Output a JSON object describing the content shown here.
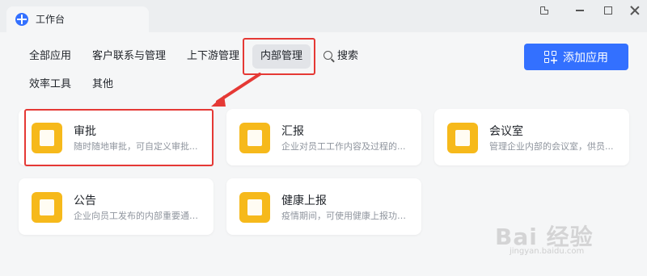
{
  "window": {
    "tab_title": "工作台",
    "icons": [
      "logo-icon",
      "pin-icon",
      "minimize-icon",
      "maximize-icon",
      "close-icon"
    ]
  },
  "nav": {
    "items": [
      {
        "label": "全部应用",
        "active": false
      },
      {
        "label": "客户联系与管理",
        "active": false
      },
      {
        "label": "上下游管理",
        "active": false
      },
      {
        "label": "内部管理",
        "active": true
      },
      {
        "label": "搜索",
        "active": false,
        "icon": "search-icon"
      },
      {
        "label": "效率工具",
        "active": false
      },
      {
        "label": "其他",
        "active": false
      }
    ],
    "add_button_label": "添加应用"
  },
  "apps": [
    {
      "name": "审批",
      "desc": "随时随地审批，可自定义审批...",
      "icon": "stamp-icon"
    },
    {
      "name": "汇报",
      "desc": "企业对员工工作内容及过程的...",
      "icon": "report-icon"
    },
    {
      "name": "会议室",
      "desc": "管理企业内部的会议室，供员...",
      "icon": "door-icon"
    },
    {
      "name": "公告",
      "desc": "企业向员工发布的内部重要通知...",
      "icon": "megaphone-icon"
    },
    {
      "name": "健康上报",
      "desc": "疫情期间，可使用健康上报功能...",
      "icon": "health-clipboard-icon"
    }
  ],
  "watermark": {
    "text": "Bai 经验",
    "sub": "jingyan.baidu.com"
  },
  "colors": {
    "accent": "#3370ff",
    "app_icon": "#f6b91b",
    "annotation": "#e53935"
  }
}
